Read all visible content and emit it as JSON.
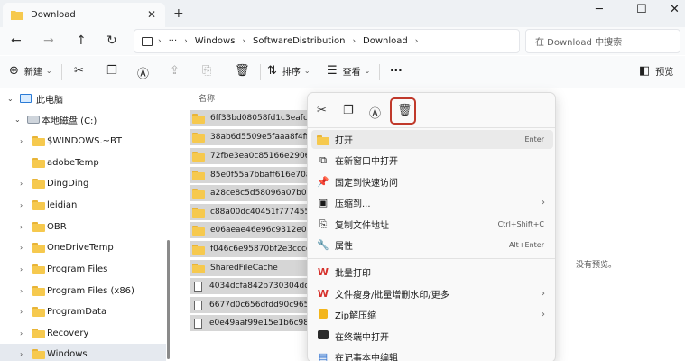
{
  "window": {
    "tab_title": "Download",
    "tab_close": "✕",
    "new_tab": "+",
    "minimize": "─",
    "maximize": "☐",
    "close": "✕"
  },
  "address": {
    "more": "···",
    "crumbs": [
      "Windows",
      "SoftwareDistribution",
      "Download"
    ],
    "separator": "›",
    "search_placeholder": "在 Download 中搜索"
  },
  "toolbar": {
    "new_label": "新建",
    "sort_label": "排序",
    "view_label": "查看",
    "more": "···",
    "preview_label": "预览"
  },
  "nav": {
    "items": [
      {
        "label": "此电脑",
        "type": "pc",
        "expanded": true
      },
      {
        "label": "本地磁盘 (C:)",
        "type": "drive",
        "expanded": true
      },
      {
        "label": "$WINDOWS.~BT",
        "type": "folder"
      },
      {
        "label": "adobeTemp",
        "type": "folder"
      },
      {
        "label": "DingDing",
        "type": "folder"
      },
      {
        "label": "leidian",
        "type": "folder"
      },
      {
        "label": "OBR",
        "type": "folder"
      },
      {
        "label": "OneDriveTemp",
        "type": "folder"
      },
      {
        "label": "Program Files",
        "type": "folder"
      },
      {
        "label": "Program Files (x86)",
        "type": "folder"
      },
      {
        "label": "ProgramData",
        "type": "folder"
      },
      {
        "label": "Recovery",
        "type": "folder"
      },
      {
        "label": "Windows",
        "type": "folder",
        "selected": true
      }
    ]
  },
  "files": {
    "column_name": "名称",
    "rows": [
      {
        "name": "6ff33bd08058fd1c3eafc5c",
        "type": "folder"
      },
      {
        "name": "38ab6d5509e5faaa8f4ff2c",
        "type": "folder"
      },
      {
        "name": "72fbe3ea0c85166e290618",
        "type": "folder"
      },
      {
        "name": "85e0f55a7bbaff616e70a9c",
        "type": "folder"
      },
      {
        "name": "a28ce8c5d58096a07b034c",
        "type": "folder"
      },
      {
        "name": "c88a00dc40451f77745524",
        "type": "folder"
      },
      {
        "name": "e06aeae46e96c9312e04d7",
        "type": "folder"
      },
      {
        "name": "f046c6e95870bf2e3cccc4",
        "type": "folder"
      },
      {
        "name": "SharedFileCache",
        "type": "folder"
      },
      {
        "name": "4034dcfa842b730304ddcf",
        "type": "file"
      },
      {
        "name": "6677d0c656dfdd90c9652",
        "type": "file"
      },
      {
        "name": "e0e49aaf99e15e1b6c9881",
        "type": "file"
      }
    ],
    "no_preview": "没有预览。"
  },
  "context_menu": {
    "items": [
      {
        "label": "打开",
        "shortcut": "Enter",
        "icon": "folder-open-icon"
      },
      {
        "label": "在新窗口中打开",
        "icon": "external-window-icon"
      },
      {
        "label": "固定到快速访问",
        "icon": "pin-icon"
      },
      {
        "label": "压缩到...",
        "icon": "zip-icon",
        "submenu": true
      },
      {
        "label": "复制文件地址",
        "shortcut": "Ctrl+Shift+C",
        "icon": "copy-path-icon"
      },
      {
        "label": "属性",
        "shortcut": "Alt+Enter",
        "icon": "properties-icon"
      },
      {
        "label": "批量打印",
        "icon": "wps-icon"
      },
      {
        "label": "文件瘦身/批量增删水印/更多",
        "icon": "wps-icon",
        "submenu": true
      },
      {
        "label": "Zip解压缩",
        "icon": "zip-icon",
        "submenu": true
      },
      {
        "label": "在终端中打开",
        "icon": "terminal-icon"
      },
      {
        "label": "在记事本中编辑",
        "icon": "notepad-icon"
      }
    ],
    "submenu_glyph": "›"
  }
}
